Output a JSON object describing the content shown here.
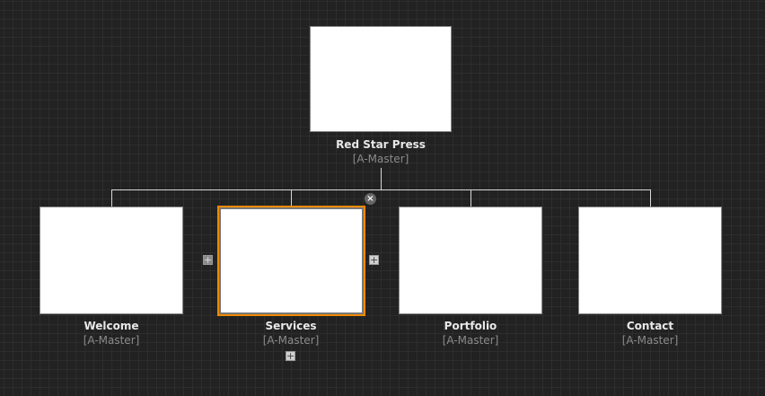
{
  "root": {
    "title": "Red Star Press",
    "master": "[A-Master]"
  },
  "pages": [
    {
      "title": "Welcome",
      "master": "[A-Master]",
      "selected": false
    },
    {
      "title": "Services",
      "master": "[A-Master]",
      "selected": true
    },
    {
      "title": "Portfolio",
      "master": "[A-Master]",
      "selected": false
    },
    {
      "title": "Contact",
      "master": "[A-Master]",
      "selected": false
    }
  ],
  "icons": {
    "add": "+",
    "close": "×"
  },
  "colors": {
    "selection": "#f08a00",
    "background": "#222222"
  }
}
